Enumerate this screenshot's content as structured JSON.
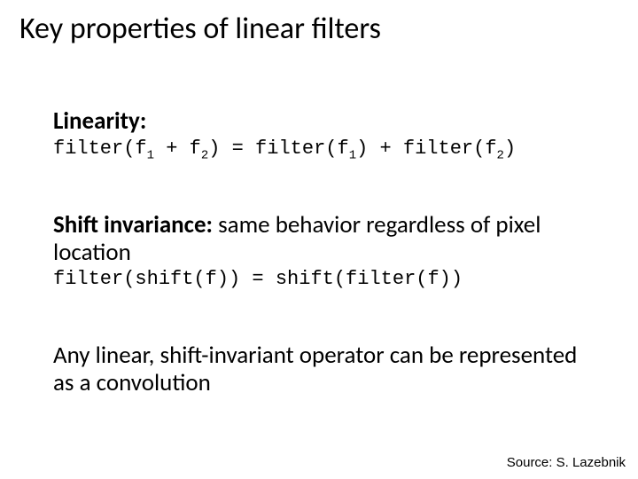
{
  "title": "Key properties of linear filters",
  "linearity": {
    "heading": "Linearity:",
    "eq_p1": "filter(f",
    "eq_s1": "1",
    "eq_p2": " + f",
    "eq_s2": "2",
    "eq_p3": ") = filter(f",
    "eq_s3": "1",
    "eq_p4": ") + filter(f",
    "eq_s4": "2",
    "eq_p5": ")"
  },
  "shift": {
    "heading_bold": "Shift invariance:",
    "heading_rest": " same behavior regardless of pixel location",
    "eq": "filter(shift(f)) = shift(filter(f))"
  },
  "conclusion": "Any linear, shift-invariant operator can be represented as a convolution",
  "source": "Source: S. Lazebnik"
}
